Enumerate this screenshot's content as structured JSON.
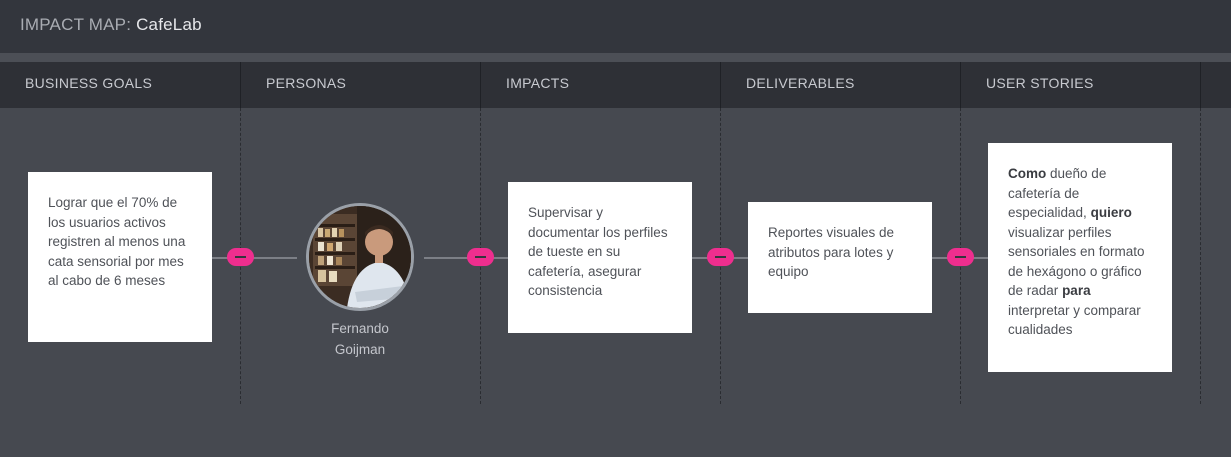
{
  "header": {
    "title_prefix": "IMPACT MAP:",
    "title_name": "CafeLab"
  },
  "columns": [
    {
      "label": "BUSINESS GOALS"
    },
    {
      "label": "PERSONAS"
    },
    {
      "label": "IMPACTS"
    },
    {
      "label": "DELIVERABLES"
    },
    {
      "label": "USER STORIES"
    }
  ],
  "business_goal": {
    "text": "Lograr que el 70% de los usuarios activos registren al menos una cata sensorial por mes al cabo de 6 meses"
  },
  "persona": {
    "name_line1": "Fernando",
    "name_line2": "Goijman"
  },
  "impact": {
    "text": "Supervisar y documentar los perfiles de tueste en su cafetería, asegurar consistencia"
  },
  "deliverable": {
    "text": "Reportes visuales de atributos para lotes y equipo"
  },
  "user_story": {
    "kw_as": "Como",
    "role": "dueño de cafetería de especialidad,",
    "kw_want": "quiero",
    "goal": "visualizar perfiles sensoriales en formato de hexágono o gráfico de radar",
    "kw_for": "para",
    "benefit": "interpretar y comparar cualidades"
  },
  "colors": {
    "accent": "#ee2e8e",
    "background": "#464950",
    "header": "#2e3036"
  },
  "icons": {
    "collapse_toggle": "minus-pill-icon"
  }
}
